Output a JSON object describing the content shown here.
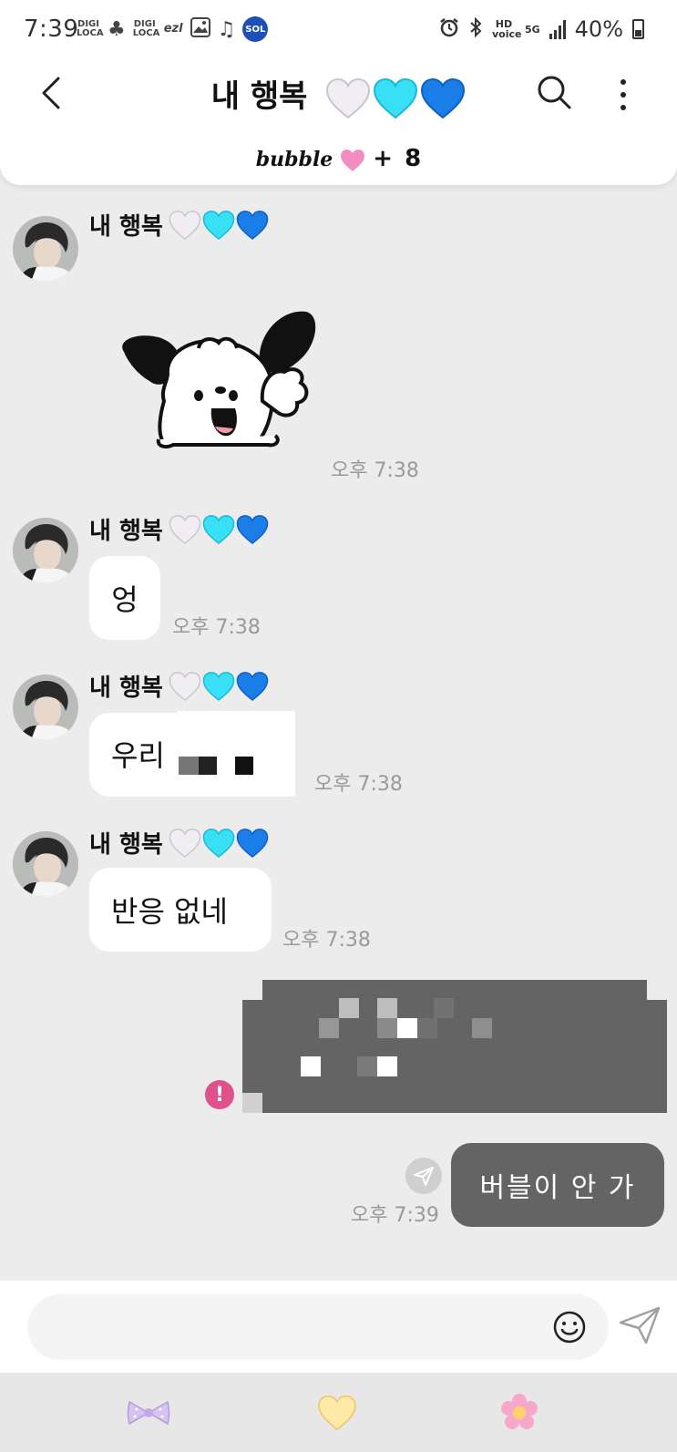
{
  "status_bar": {
    "time": "7:39",
    "left_logos": [
      "DIGI LOCA",
      "DIGI LOCA",
      "ezl"
    ],
    "sol_badge": "SOL",
    "hd_label": "HD voice",
    "network": "5G",
    "battery": "40%"
  },
  "header": {
    "title": "내 행복",
    "bubble_brand": "bubble",
    "bubble_plus": "+",
    "bubble_count": "8"
  },
  "messages": [
    {
      "sender": "내 행복",
      "type": "sticker",
      "time": "오후 7:38"
    },
    {
      "sender": "내 행복",
      "type": "text",
      "text": "엉",
      "time": "오후 7:38"
    },
    {
      "sender": "내 행복",
      "type": "text",
      "text": "우리",
      "time": "오후 7:38"
    },
    {
      "sender": "내 행복",
      "type": "text",
      "text": "반응 없네",
      "time": "오후 7:38"
    },
    {
      "type": "outgoing_censored",
      "status_icon": "!"
    },
    {
      "type": "outgoing",
      "text": "버블이 안 가",
      "time": "오후 7:39"
    }
  ],
  "input": {
    "placeholder": "",
    "value": ""
  },
  "colors": {
    "background": "#ececec",
    "outgoing_bubble": "#646464",
    "error_badge": "#e0508a",
    "heart_white": "#f0eef2",
    "heart_cyan": "#38e0f5",
    "heart_blue": "#1a7de8",
    "bubble_pink_heart": "#f08cc0"
  },
  "bottom_tabs": [
    "bow-icon",
    "heart-icon",
    "flower-icon"
  ]
}
